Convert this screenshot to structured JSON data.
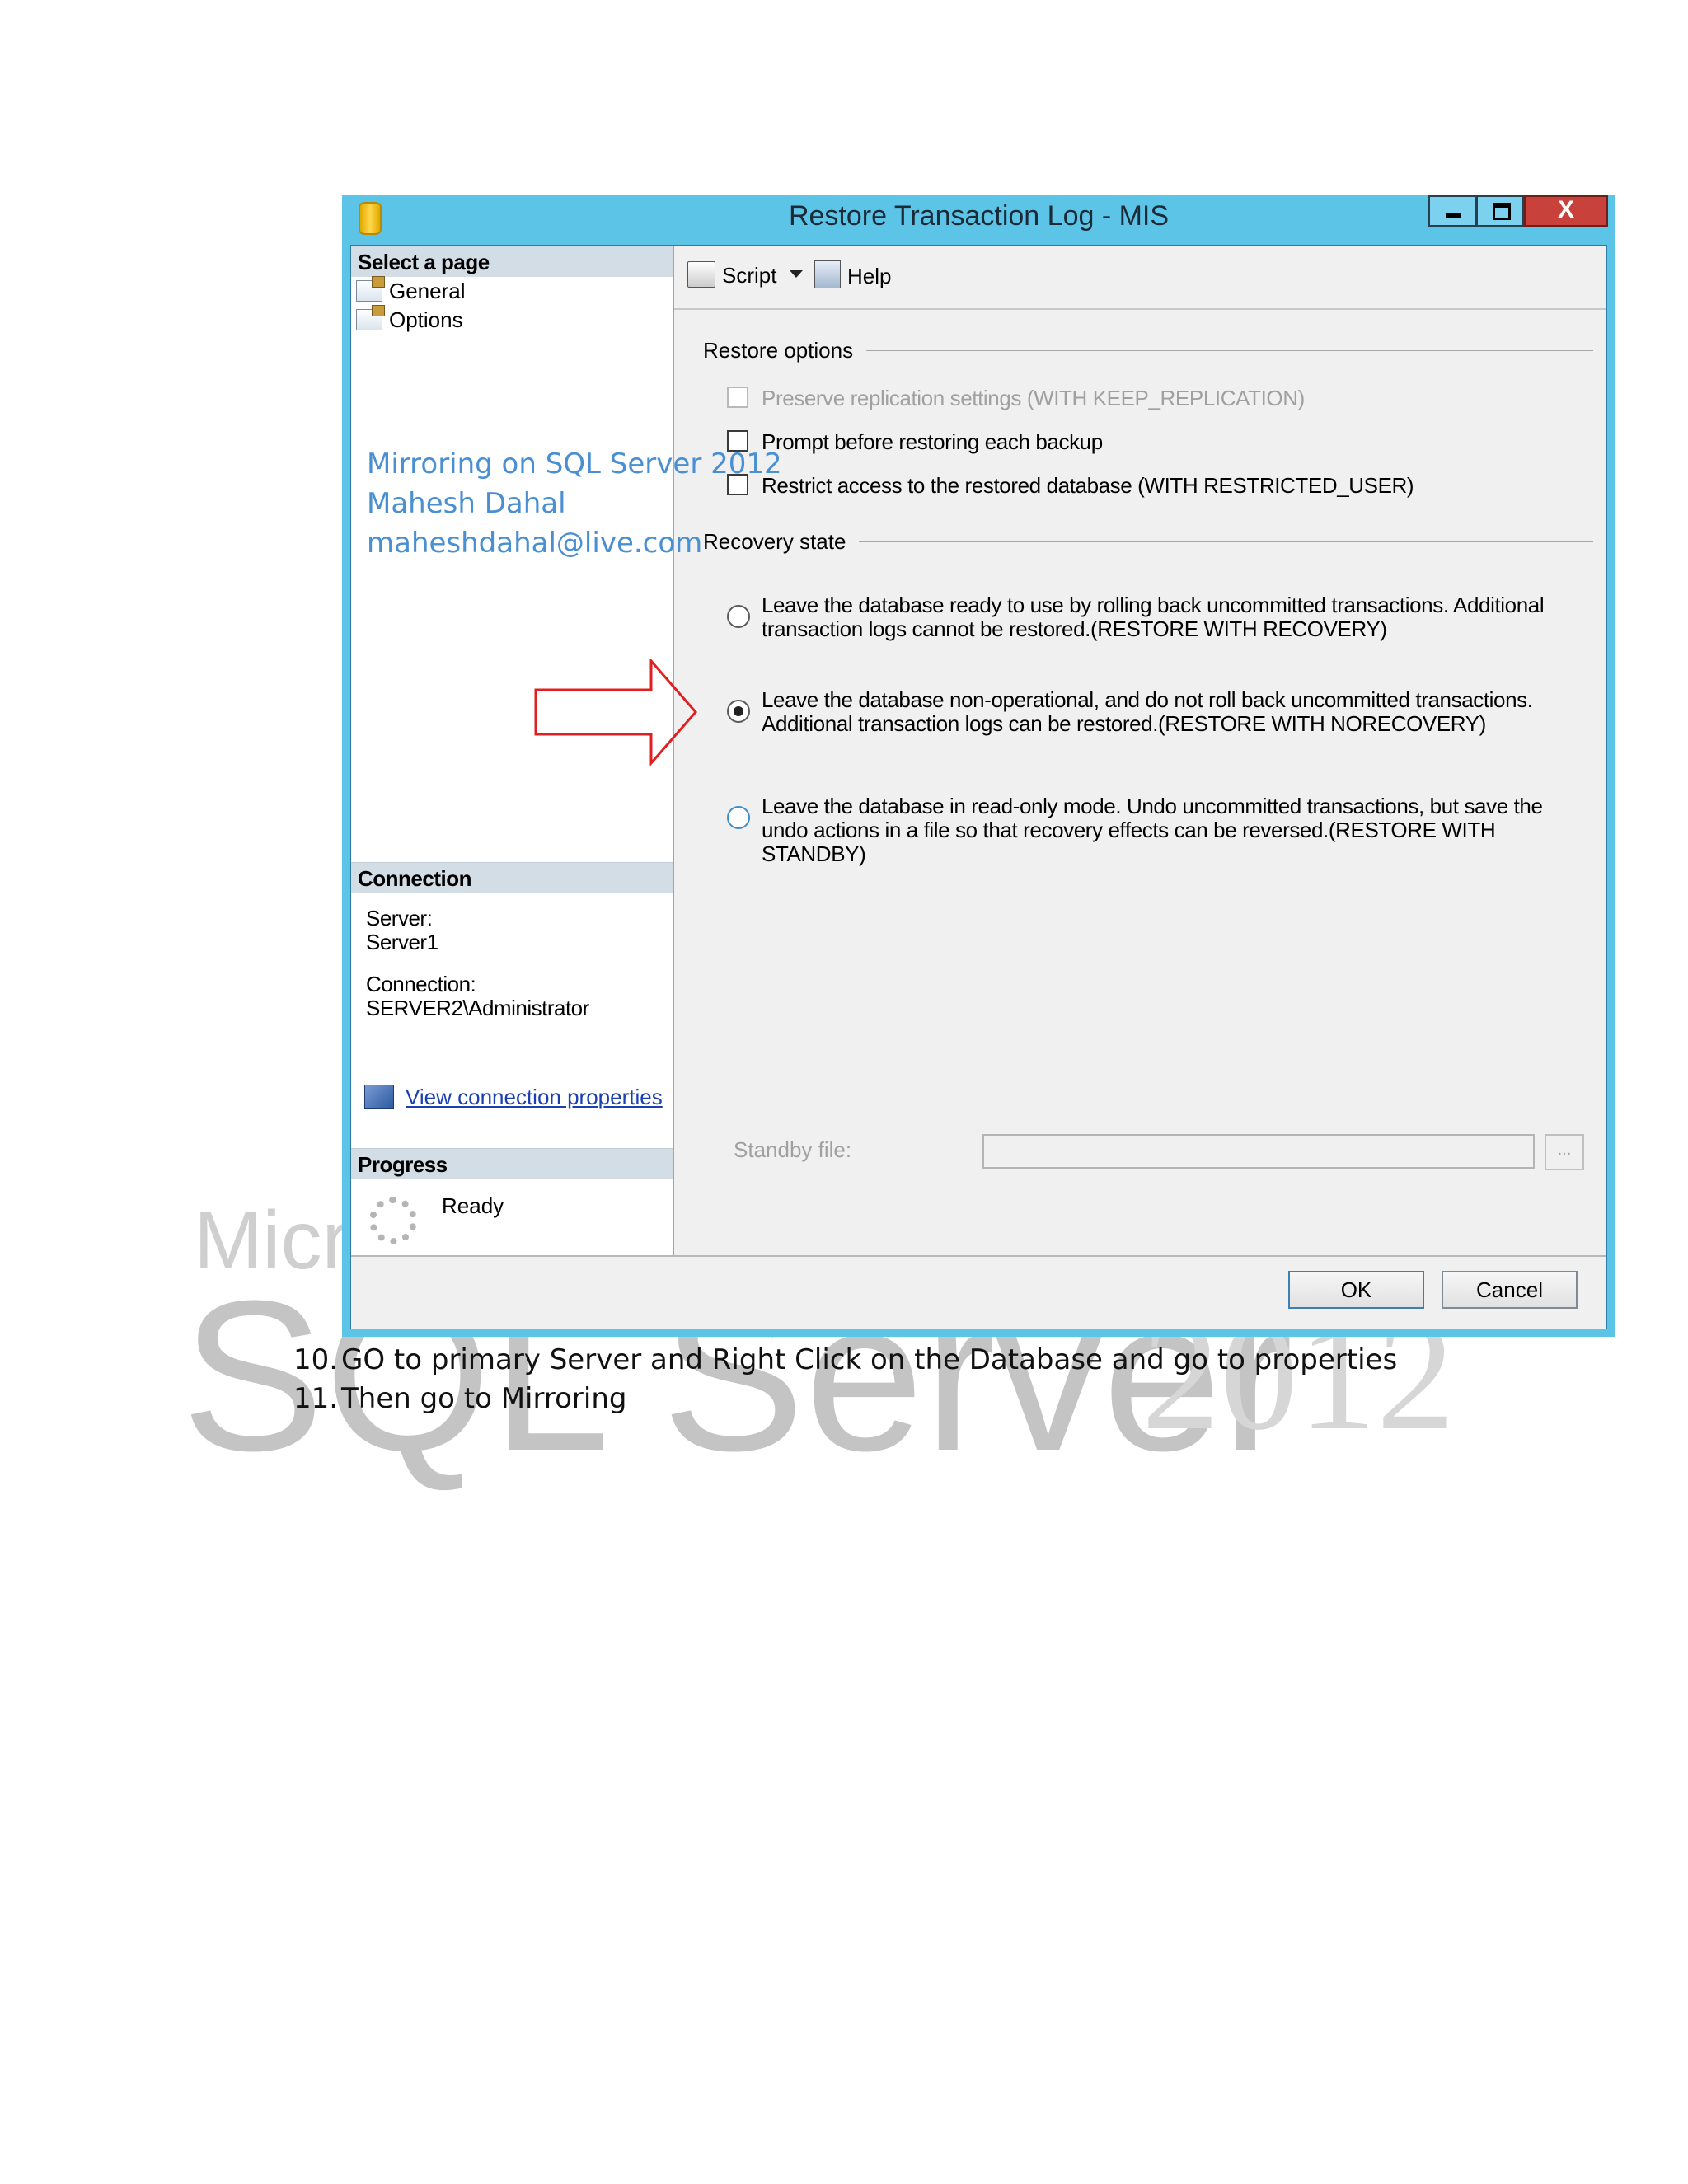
{
  "watermark": {
    "line1": "Micr",
    "line2": "SQL Server",
    "year": "2012"
  },
  "window": {
    "title": "Restore Transaction Log  -  MIS",
    "close_glyph": "X"
  },
  "left_pane": {
    "select_header": "Select a page",
    "pages": [
      "General",
      "Options"
    ],
    "connection_header": "Connection",
    "server_label": "Server:",
    "server_value": "Server1",
    "connection_label": "Connection:",
    "connection_value": "SERVER2\\Administrator",
    "view_link": "View connection properties",
    "progress_header": "Progress",
    "progress_status": "Ready"
  },
  "overlay": {
    "line1": "Mirroring on SQL Server 2012",
    "line2": "Mahesh Dahal",
    "line3": "maheshdahal@live.com"
  },
  "toolbar": {
    "script": "Script",
    "help": "Help"
  },
  "restore_options": {
    "label": "Restore options",
    "items": [
      {
        "label": "Preserve replication settings (WITH KEEP_REPLICATION)",
        "checked": false,
        "enabled": false
      },
      {
        "label": "Prompt before restoring each backup",
        "checked": false,
        "enabled": true
      },
      {
        "label": "Restrict access to the restored database (WITH RESTRICTED_USER)",
        "checked": false,
        "enabled": true
      }
    ]
  },
  "recovery_state": {
    "label": "Recovery state",
    "options": [
      {
        "label": "Leave the database ready to use by rolling back uncommitted transactions. Additional transaction logs cannot be restored.(RESTORE WITH RECOVERY)",
        "selected": false
      },
      {
        "label": "Leave the database non-operational, and do not roll back uncommitted transactions. Additional transaction logs can be restored.(RESTORE WITH NORECOVERY)",
        "selected": true
      },
      {
        "label": "Leave the database in read-only mode. Undo uncommitted transactions, but save the undo actions in a file so that recovery effects can be reversed.(RESTORE WITH STANDBY)",
        "selected": false
      }
    ]
  },
  "standby": {
    "label": "Standby file:",
    "value": "",
    "browse": "..."
  },
  "buttons": {
    "ok": "OK",
    "cancel": "Cancel"
  },
  "document": {
    "steps": [
      {
        "num": "10.",
        "text": "GO to primary Server and Right Click on the Database and go to properties"
      },
      {
        "num": "11.",
        "text": "Then go to Mirroring"
      }
    ]
  }
}
